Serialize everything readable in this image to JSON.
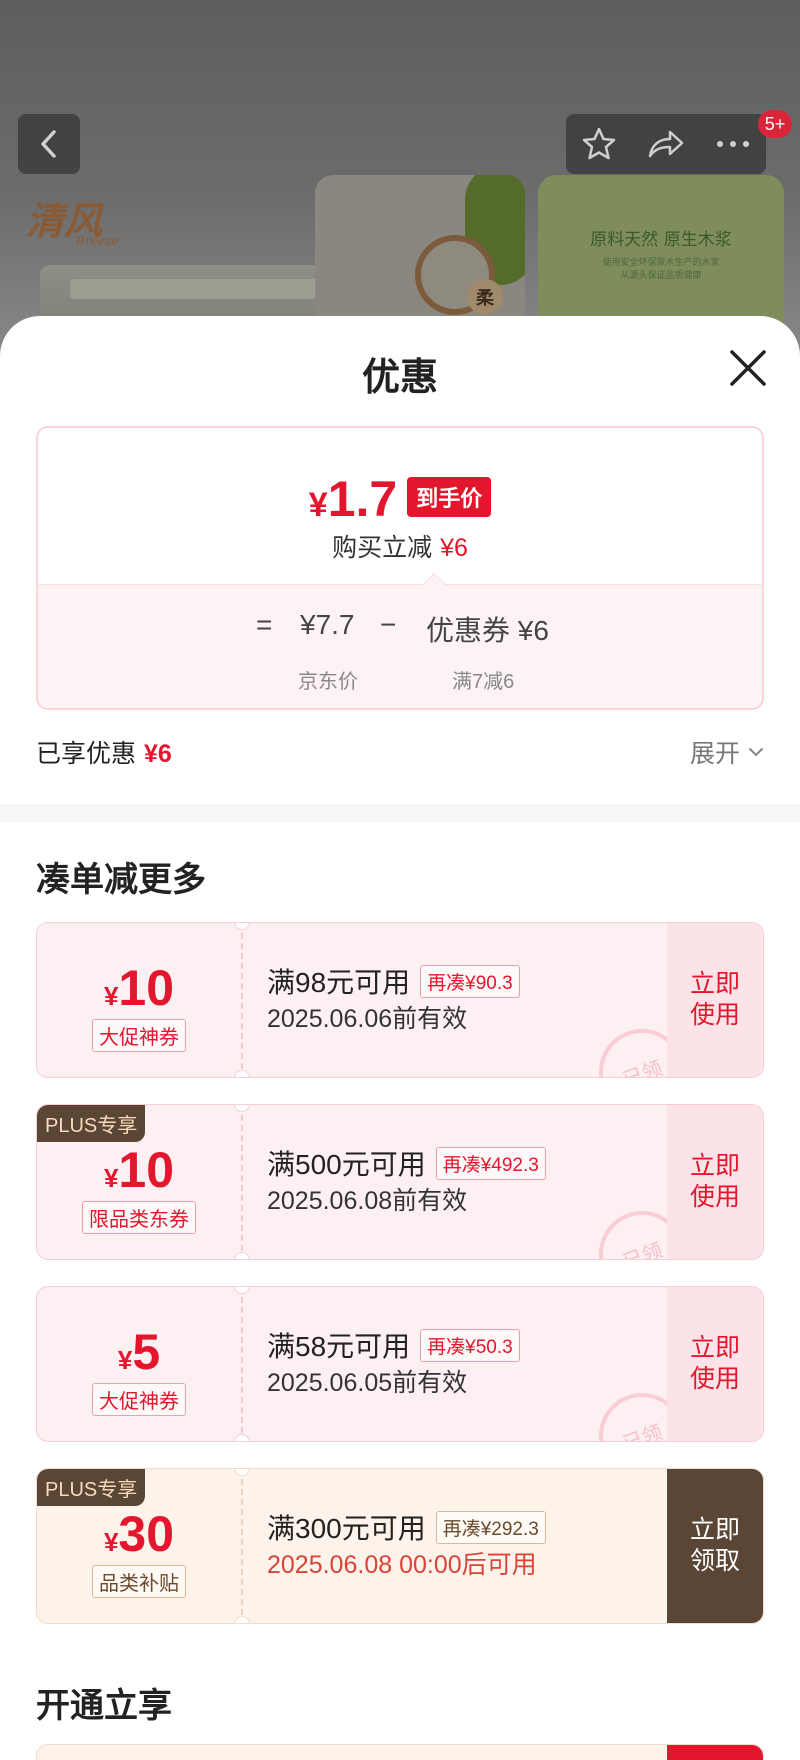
{
  "colors": {
    "accent": "#e3162d",
    "plus_dark": "#5b4636"
  },
  "background": {
    "brand_logo": "清风",
    "brand_sub": "Breeze",
    "badge_char": "柔",
    "card_text_1": "原料天然 原生木浆",
    "card_text_2": "使用安全环保原木生产的木浆",
    "card_text_3": "从源头保证品质健康",
    "top_badge_count": "5+",
    "icons": [
      "chevron-left-icon",
      "star-icon",
      "share-icon",
      "more-icon"
    ]
  },
  "sheet": {
    "title": "优惠",
    "close_icon": "close-icon"
  },
  "price_card": {
    "currency": "¥",
    "final_price": "1.7",
    "final_tag": "到手价",
    "reduce_label": "购买立减",
    "reduce_amount": "¥6",
    "eq_sign": "=",
    "base_price": "¥7.7",
    "minus_sign": "−",
    "coupon_part": "优惠券 ¥6",
    "base_label": "京东价",
    "coupon_label": "满7减6"
  },
  "enjoyed": {
    "label": "已享优惠",
    "amount": "¥6",
    "expand_label": "展开"
  },
  "section_more": {
    "title": "凑单减更多"
  },
  "coupons": [
    {
      "plus_tag": "",
      "currency": "¥",
      "amount": "10",
      "type": "大促神券",
      "condition": "满98元可用",
      "more": "再凑¥90.3",
      "validity": "2025.06.06前有效",
      "action": "立即使用",
      "stamp": "已领"
    },
    {
      "plus_tag": "PLUS专享",
      "currency": "¥",
      "amount": "10",
      "type": "限品类东券",
      "condition": "满500元可用",
      "more": "再凑¥492.3",
      "validity": "2025.06.08前有效",
      "action": "立即使用",
      "stamp": "已领"
    },
    {
      "plus_tag": "",
      "currency": "¥",
      "amount": "5",
      "type": "大促神券",
      "condition": "满58元可用",
      "more": "再凑¥50.3",
      "validity": "2025.06.05前有效",
      "action": "立即使用",
      "stamp": "已领"
    },
    {
      "plus_tag": "PLUS专享",
      "currency": "¥",
      "amount": "30",
      "type": "品类补贴",
      "condition": "满300元可用",
      "more": "再凑¥292.3",
      "validity": "2025.06.08 00:00后可用",
      "action": "立即领取",
      "stamp": ""
    }
  ],
  "section_open": {
    "title": "开通立享"
  }
}
